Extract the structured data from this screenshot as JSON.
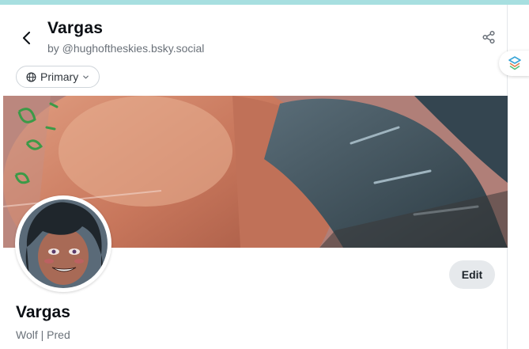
{
  "header": {
    "title": "Vargas",
    "subtitle": "by @hughoftheskies.bsky.social"
  },
  "feed_selector": {
    "label": "Primary"
  },
  "profile": {
    "display_name": "Vargas",
    "description": "Wolf | Pred",
    "edit_label": "Edit"
  },
  "icons": {
    "back": "chevron-left-icon",
    "share": "share-icon",
    "globe": "globe-icon",
    "dropdown": "chevron-down-icon",
    "widget": "layers-icon"
  },
  "colors": {
    "top_strip": "#a7dfe0",
    "edit_button_bg": "#e6e9ec",
    "muted_text": "#6a7179"
  }
}
